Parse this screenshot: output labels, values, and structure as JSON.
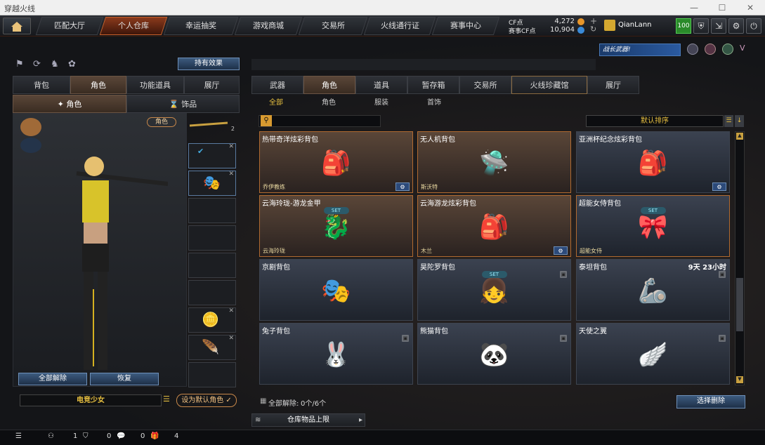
{
  "window": {
    "title": "穿越火线"
  },
  "nav": {
    "tabs": [
      "匹配大厅",
      "个人仓库",
      "幸运抽奖",
      "游戏商城",
      "交易所",
      "火线通行证",
      "赛事中心"
    ],
    "active_index": 1,
    "cf_label": "CF点",
    "cf_value": "4,272",
    "event_cf_label": "赛事CF点",
    "event_cf_value": "10,904",
    "username": "QianLann",
    "level_badge": "100"
  },
  "left": {
    "effects_button": "持有效果",
    "tabs": [
      "背包",
      "角色",
      "功能道具",
      "展厅"
    ],
    "active_tab": 1,
    "sub_tabs": [
      "角色",
      "饰品"
    ],
    "role_tag": "角色",
    "unequip_all": "全部解除",
    "restore": "恢复",
    "character_name": "电竞少女",
    "set_default": "设为默认角色",
    "weapon_level": "2"
  },
  "right": {
    "banner": "战长武器!",
    "tabs": [
      "武器",
      "角色",
      "道具",
      "暂存箱",
      "交易所",
      "火线珍藏馆",
      "展厅"
    ],
    "active_tab": 1,
    "sub_tabs": [
      "全部",
      "角色",
      "服装",
      "首饰"
    ],
    "sort_label": "默认排序",
    "items": [
      {
        "name": "热带奇洋炫彩背包",
        "sub": "乔伊教练",
        "style": "gold",
        "art": "🎒",
        "gear": true
      },
      {
        "name": "无人机背包",
        "sub": "斯沃特",
        "style": "gold",
        "art": "🛸",
        "gear": false
      },
      {
        "name": "亚洲杯纪念炫彩背包",
        "sub": "",
        "style": "normal",
        "art": "🎒",
        "gear": true
      },
      {
        "name": "云海玲珑-游龙金甲",
        "sub": "云海玲珑",
        "style": "gold",
        "art": "🐉",
        "tag": "SET",
        "gear": false
      },
      {
        "name": "云海游龙炫彩背包",
        "sub": "木兰",
        "style": "gold",
        "art": "🎒",
        "gear": true
      },
      {
        "name": "超能女侍背包",
        "sub": "超能女侍",
        "style": "gold2",
        "art": "🎀",
        "tag": "SET",
        "gear": false
      },
      {
        "name": "京剧背包",
        "sub": "",
        "style": "normal",
        "art": "🎭",
        "gear": false
      },
      {
        "name": "昊陀罗背包",
        "sub": "",
        "style": "normal",
        "art": "👧",
        "tag": "SET",
        "lock": true
      },
      {
        "name": "泰坦背包",
        "sub": "",
        "style": "normal",
        "art": "🦾",
        "time": "9天 23小时",
        "lock": true
      },
      {
        "name": "兔子背包",
        "sub": "",
        "style": "normal",
        "art": "🐰",
        "lock": true
      },
      {
        "name": "熊猫背包",
        "sub": "",
        "style": "normal",
        "art": "🐼",
        "lock": true
      },
      {
        "name": "天使之翼",
        "sub": "",
        "style": "normal",
        "art": "🪽",
        "lock": true
      }
    ],
    "unequip_status": "全部解除:",
    "unequip_count": "0个/6个",
    "select_delete": "选择删除",
    "warehouse_limit": "仓库物品上限"
  },
  "bottom": {
    "count1": "1",
    "count2": "0",
    "count3": "0",
    "count4": "4"
  }
}
